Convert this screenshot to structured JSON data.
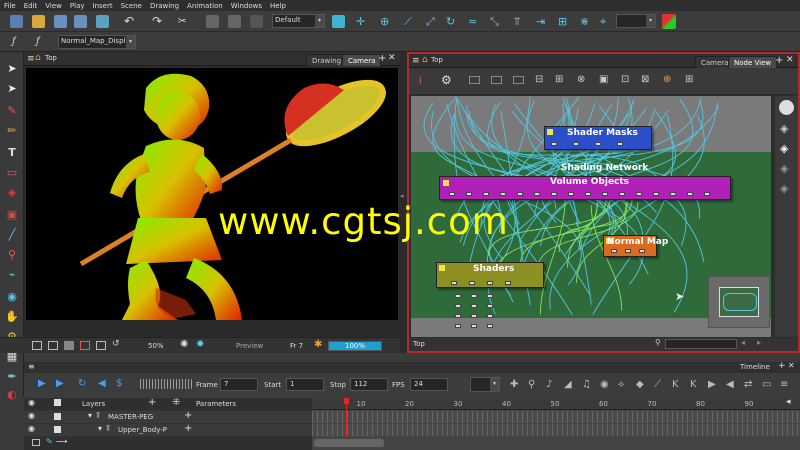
{
  "menu": [
    "File",
    "Edit",
    "View",
    "Play",
    "Insert",
    "Scene",
    "Drawing",
    "Animation",
    "Windows",
    "Help"
  ],
  "toolbar": {
    "workspace_select": "Default",
    "display_select": "Normal_Map_Display"
  },
  "camera_view": {
    "title": "Top",
    "tabs": [
      "Drawing",
      "Camera"
    ],
    "footer": {
      "zoom": "50%",
      "preview": "Preview",
      "frame": "Fr 7",
      "progress_label": "100%",
      "progress": 1.0
    }
  },
  "node_view": {
    "title": "Top",
    "tabs": [
      "Camera",
      "Node View"
    ],
    "group_label": "Shading Network",
    "nodes": {
      "shader_masks": "Shader Masks",
      "volume_objects": "Volume Objects",
      "normal_map": "Normal Map",
      "shaders": "Shaders"
    },
    "footer_label": "Top"
  },
  "timeline": {
    "title": "Timeline",
    "frame_label": "Frame",
    "frame_value": "7",
    "start_label": "Start",
    "start_value": "1",
    "stop_label": "Stop",
    "stop_value": "112",
    "fps_label": "FPS",
    "fps_value": "24",
    "layers_label": "Layers",
    "parameters_label": "Parameters",
    "layers": [
      "MASTER-PEG",
      "Upper_Body-P"
    ],
    "ruler": [
      "10",
      "20",
      "30",
      "40",
      "50",
      "60",
      "70",
      "80",
      "90"
    ],
    "playhead_frame": 7
  },
  "watermark": "www.cgtsj.com",
  "colors": {
    "accent_red": "#b32a2a",
    "shader_masks": "#2b4fc8",
    "volume_objects": "#b01fb6",
    "normal_map": "#d96a1f",
    "shaders": "#8d8f23",
    "progress": "#1e9fd0",
    "watermark": "#ffff00"
  }
}
